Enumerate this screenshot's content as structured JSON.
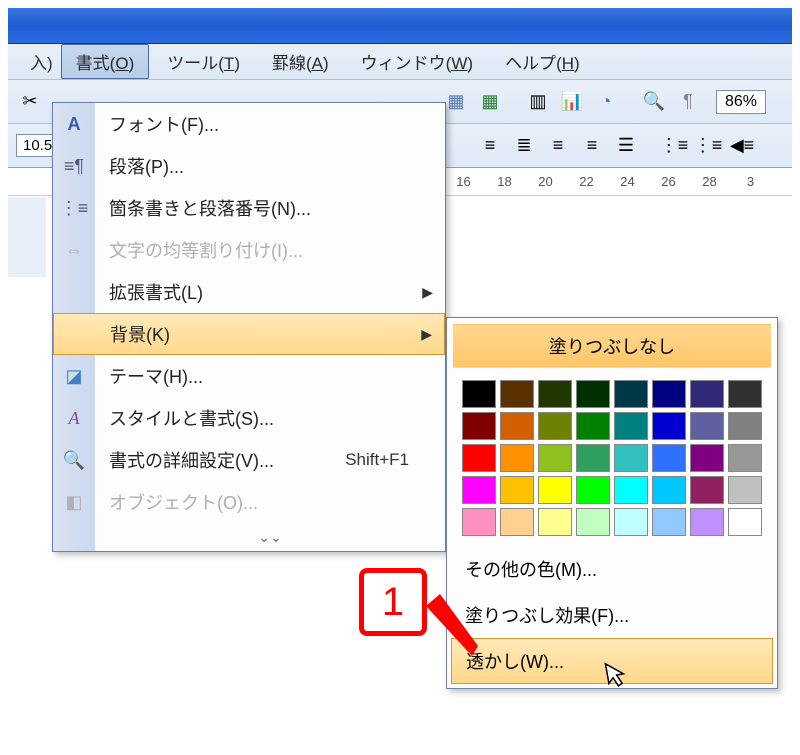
{
  "menubar": {
    "items": [
      {
        "label": "書式",
        "accel": "O",
        "active": true
      },
      {
        "label": "ツール",
        "accel": "T"
      },
      {
        "label": "罫線",
        "accel": "A"
      },
      {
        "label": "ウィンドウ",
        "accel": "W"
      },
      {
        "label": "ヘルプ",
        "accel": "H"
      }
    ]
  },
  "toolbar": {
    "zoom": "86%",
    "fontsize": "10.5"
  },
  "ruler": {
    "ticks": [
      "16",
      "18",
      "20",
      "22",
      "24",
      "26",
      "28",
      "3"
    ]
  },
  "dropdown": {
    "items": [
      {
        "icon": "A",
        "label": "フォント(F)...",
        "enabled": true
      },
      {
        "icon": "para",
        "label": "段落(P)...",
        "enabled": true
      },
      {
        "icon": "list",
        "label": "箇条書きと段落番号(N)...",
        "enabled": true
      },
      {
        "icon": "",
        "label": "文字の均等割り付け(I)...",
        "enabled": false
      },
      {
        "icon": "",
        "label": "拡張書式(L)",
        "enabled": true,
        "submenu": true
      },
      {
        "icon": "",
        "label": "背景(K)",
        "enabled": true,
        "submenu": true,
        "highlighted": true
      },
      {
        "icon": "theme",
        "label": "テーマ(H)...",
        "enabled": true
      },
      {
        "icon": "style",
        "label": "スタイルと書式(S)...",
        "enabled": true
      },
      {
        "icon": "reveal",
        "label": "書式の詳細設定(V)...",
        "shortcut": "Shift+F1",
        "enabled": true
      },
      {
        "icon": "",
        "label": "オブジェクト(O)...",
        "enabled": false
      }
    ]
  },
  "submenu": {
    "header": "塗りつぶしなし",
    "colors": [
      [
        "#000000",
        "#5a3000",
        "#203800",
        "#003000",
        "#003848",
        "#000080",
        "#302878",
        "#303030"
      ],
      [
        "#800000",
        "#d06000",
        "#708000",
        "#008000",
        "#008080",
        "#0000d0",
        "#6060a0",
        "#808080"
      ],
      [
        "#ff0000",
        "#ff9000",
        "#90c020",
        "#30a060",
        "#30c0c0",
        "#3070ff",
        "#800080",
        "#989898"
      ],
      [
        "#ff00ff",
        "#ffc000",
        "#ffff00",
        "#00ff00",
        "#00ffff",
        "#00c8ff",
        "#902060",
        "#c0c0c0"
      ],
      [
        "#ff90c0",
        "#ffd090",
        "#ffff90",
        "#c0ffc0",
        "#c0ffff",
        "#90c8ff",
        "#c090ff",
        "#ffffff"
      ]
    ],
    "more_colors": "その他の色(M)...",
    "fill_effects": "塗りつぶし効果(F)...",
    "watermark": "透かし(W)..."
  },
  "annotation": {
    "number": "1"
  }
}
